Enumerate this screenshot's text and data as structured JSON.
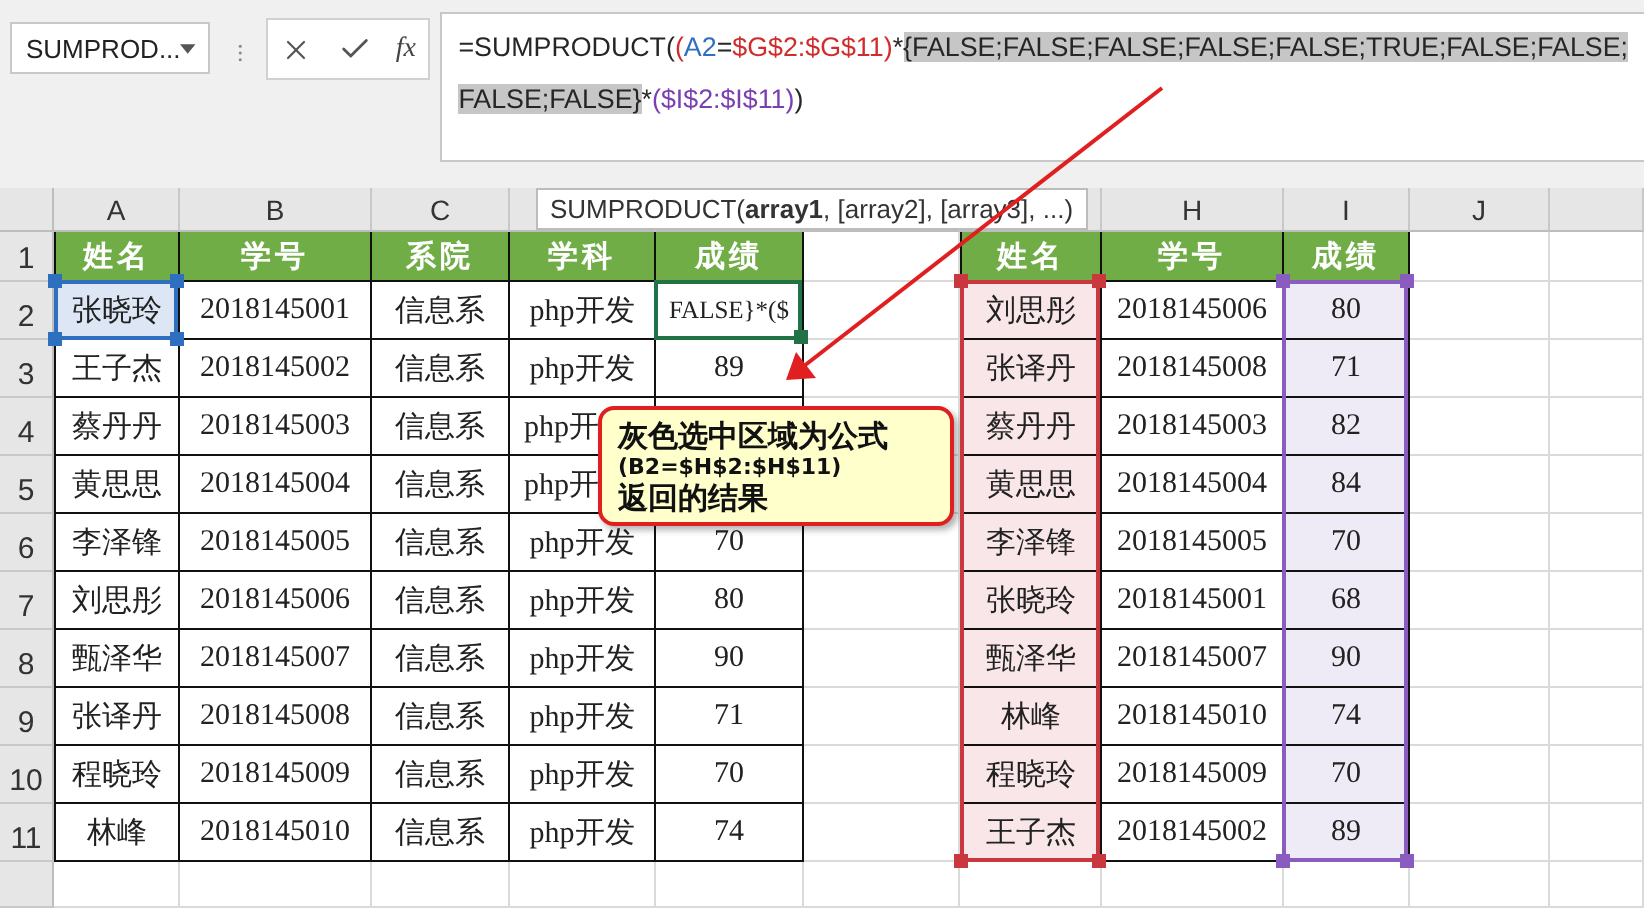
{
  "name_box": {
    "value": "SUMPROD..."
  },
  "formula_bar": {
    "insert_function_label": "fx",
    "lines": [
      [
        {
          "text": "=SUMPRODUCT(",
          "color": "#262626",
          "selected": false
        },
        {
          "text": "(",
          "color": "#d02c2c",
          "selected": false
        },
        {
          "text": "A2",
          "color": "#2f6fc0",
          "selected": false
        },
        {
          "text": "=",
          "color": "#262626",
          "selected": false
        },
        {
          "text": "$G$2:$G$11",
          "color": "#d02c2c",
          "selected": false
        },
        {
          "text": ")",
          "color": "#d02c2c",
          "selected": false
        },
        {
          "text": "*",
          "color": "#262626",
          "selected": false
        },
        {
          "text": "{FALSE;FALSE;FALSE;FALSE;FALSE;TRUE;FALSE;FALSE;",
          "color": "#262626",
          "selected": true
        }
      ],
      [
        {
          "text": "FALSE;FALSE}",
          "color": "#262626",
          "selected": true
        },
        {
          "text": "*",
          "color": "#262626",
          "selected": false
        },
        {
          "text": "(",
          "color": "#7a3fb0",
          "selected": false
        },
        {
          "text": "$I$2:$I$11",
          "color": "#7a3fb0",
          "selected": false
        },
        {
          "text": ")",
          "color": "#7a3fb0",
          "selected": false
        },
        {
          "text": ")",
          "color": "#262626",
          "selected": false
        }
      ]
    ]
  },
  "column_headers": {
    "left": [
      "A",
      "B",
      "C"
    ],
    "right": [
      "H",
      "I",
      "J"
    ]
  },
  "row_numbers": [
    "1",
    "2",
    "3",
    "4",
    "5",
    "6",
    "7",
    "8",
    "9",
    "10",
    "11"
  ],
  "tooltip": "SUMPRODUCT(**array1**, [array2], [array3], ...)",
  "left_table": {
    "columns": [
      "姓名",
      "学号",
      "系院",
      "学科",
      "成绩"
    ],
    "rows": [
      {
        "cells": [
          "张晓玲",
          "2018145001",
          "信息系",
          "php开发",
          "FALSE}*($"
        ],
        "selected": true,
        "editing": true
      },
      {
        "cells": [
          "王子杰",
          "2018145002",
          "信息系",
          "php开发",
          "89"
        ],
        "selected": false,
        "editing": false
      },
      {
        "cells": [
          "蔡丹丹",
          "2018145003",
          "信息系",
          "php开"
        ],
        "selected": false,
        "editing": false
      },
      {
        "cells": [
          "黄思思",
          "2018145004",
          "信息系",
          "php开"
        ],
        "selected": false,
        "editing": false
      },
      {
        "cells": [
          "李泽锋",
          "2018145005",
          "信息系",
          "php开发",
          "70"
        ],
        "selected": false,
        "editing": false
      },
      {
        "cells": [
          "刘思彤",
          "2018145006",
          "信息系",
          "php开发",
          "80"
        ],
        "selected": false,
        "editing": false
      },
      {
        "cells": [
          "甄泽华",
          "2018145007",
          "信息系",
          "php开发",
          "90"
        ],
        "selected": false,
        "editing": false
      },
      {
        "cells": [
          "张译丹",
          "2018145008",
          "信息系",
          "php开发",
          "71"
        ],
        "selected": false,
        "editing": false
      },
      {
        "cells": [
          "程晓玲",
          "2018145009",
          "信息系",
          "php开发",
          "70"
        ],
        "selected": false,
        "editing": false
      },
      {
        "cells": [
          "林峰",
          "2018145010",
          "信息系",
          "php开发",
          "74"
        ],
        "selected": false,
        "editing": false
      }
    ]
  },
  "right_table": {
    "columns": [
      {
        "header": "姓名",
        "color": "#c9383f"
      },
      {
        "header": "学号"
      },
      {
        "header": "成绩",
        "color": "#8a5cc0"
      }
    ],
    "rows": [
      [
        "刘思彤",
        "2018145006",
        "80"
      ],
      [
        "张译丹",
        "2018145008",
        "71"
      ],
      [
        "蔡丹丹",
        "2018145003",
        "82"
      ],
      [
        "黄思思",
        "2018145004",
        "84"
      ],
      [
        "李泽锋",
        "2018145005",
        "70"
      ],
      [
        "张晓玲",
        "2018145001",
        "68"
      ],
      [
        "甄泽华",
        "2018145007",
        "90"
      ],
      [
        "林峰",
        "2018145010",
        "74"
      ],
      [
        "程晓玲",
        "2018145009",
        "70"
      ],
      [
        "王子杰",
        "2018145002",
        "89"
      ]
    ]
  },
  "callout": {
    "lines": [
      "灰色选中区域为公式",
      "(B2=$H$2:$H$11)",
      "返回的结果"
    ]
  }
}
